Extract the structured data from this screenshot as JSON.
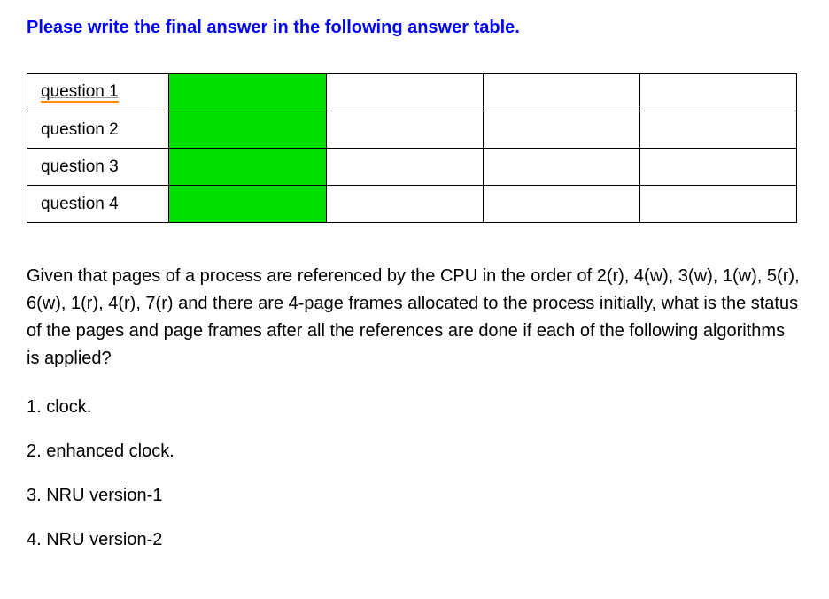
{
  "instruction": "Please write the final answer in the following answer table.",
  "table": {
    "rows": [
      {
        "label": "question 1",
        "underlined": true
      },
      {
        "label": "question 2",
        "underlined": false
      },
      {
        "label": "question 3",
        "underlined": false
      },
      {
        "label": "question 4",
        "underlined": false
      }
    ]
  },
  "question_text": "Given that pages of a process are referenced by the CPU in the order of 2(r), 4(w), 3(w), 1(w), 5(r), 6(w), 1(r), 4(r), 7(r) and there are 4-page frames allocated to the process initially, what is the status of the pages and page frames after all the references are done if each of the following algorithms is applied?",
  "items": [
    "1. clock.",
    "2. enhanced clock.",
    "3. NRU version-1",
    "4. NRU version-2"
  ]
}
